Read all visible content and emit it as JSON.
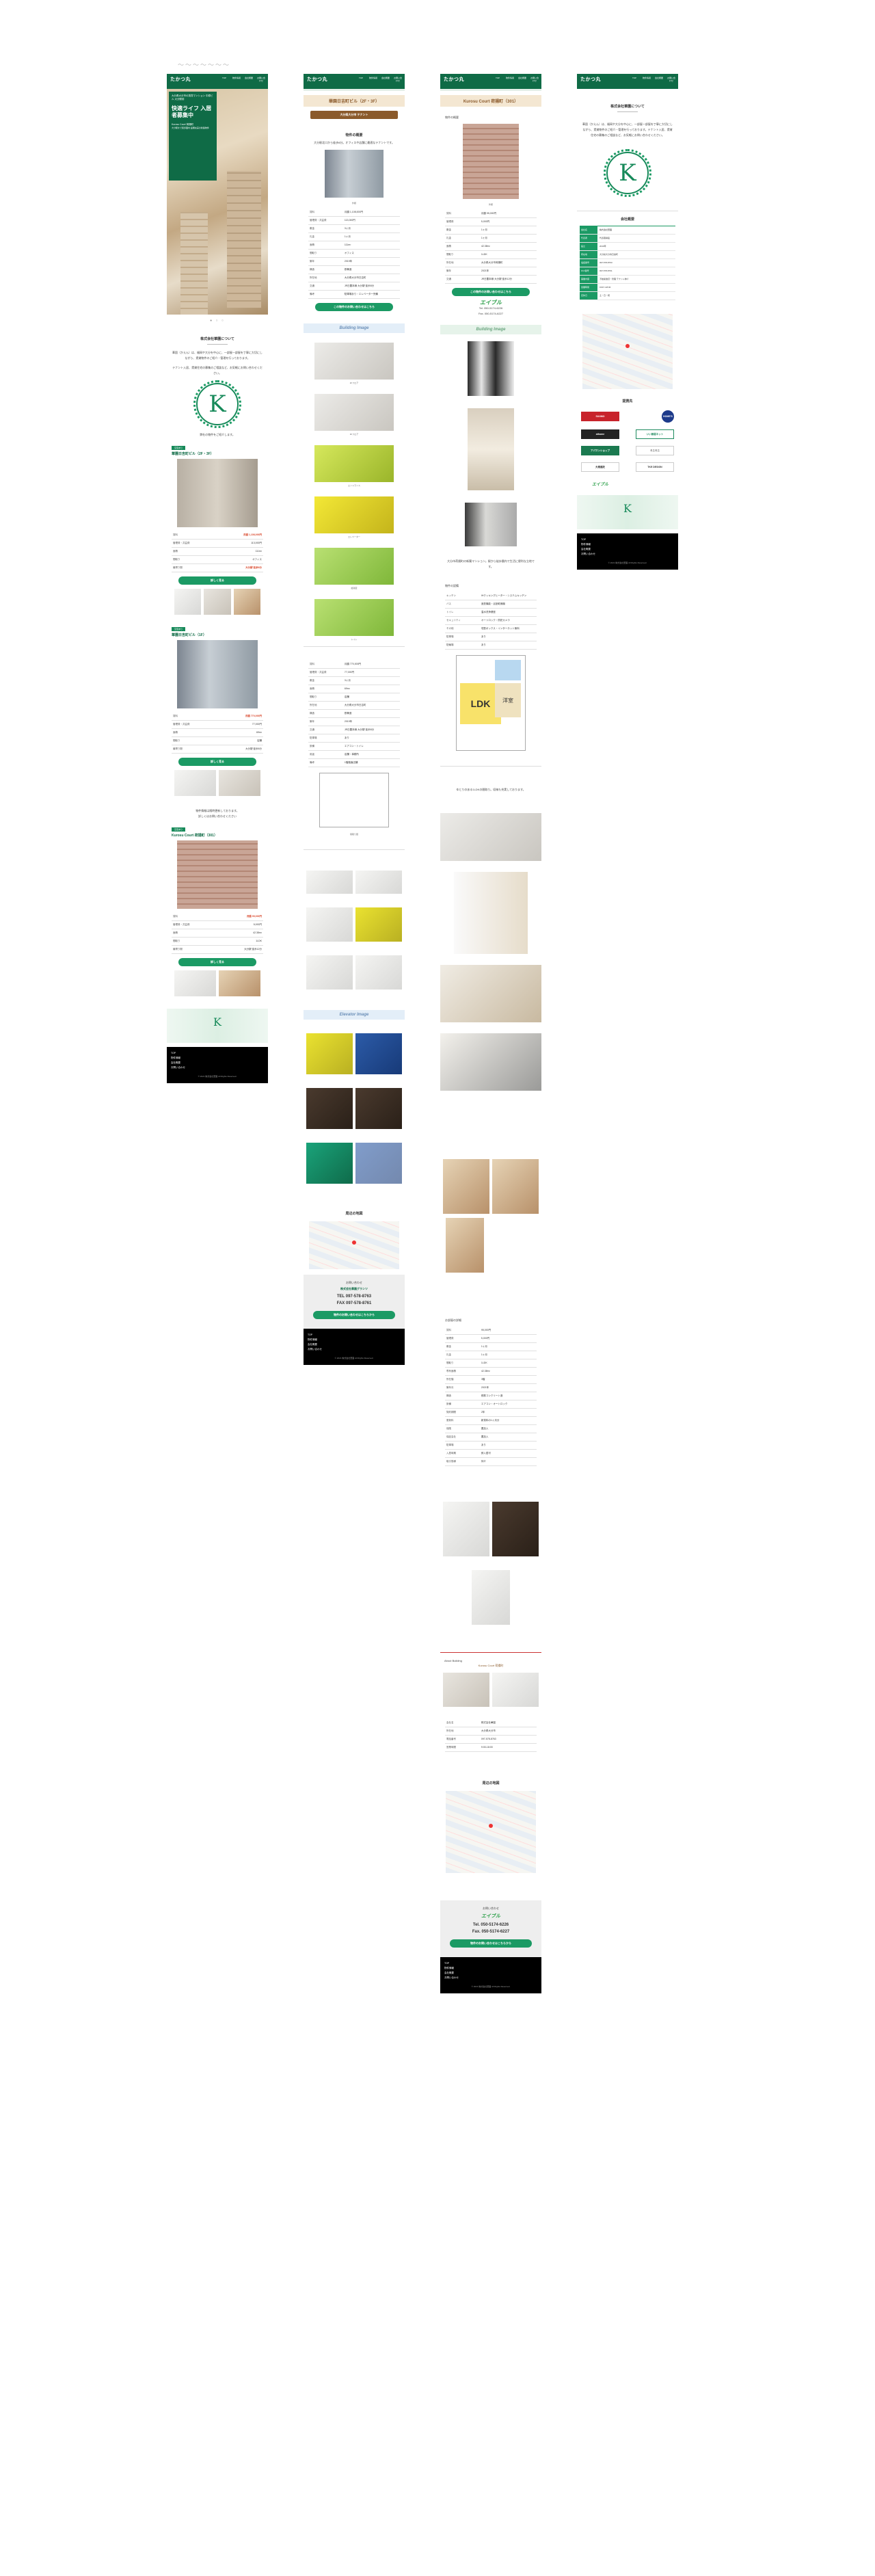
{
  "header": {
    "logo": "たかつ丸",
    "nav": [
      "TOP",
      "物件情報",
      "会社概要",
      "お問い合わせ"
    ]
  },
  "col1": {
    "hero_panel": {
      "line1": "大分県大分市の賃貸マンション 中原ビル 大分駅前",
      "headline": "快適ライフ 入居者募集中",
      "sub": "Kurosu Court 荷揚町",
      "note": "大分駅まで徒歩圏内 設備充実の新築物件"
    },
    "company_title": "株式会社華園について",
    "company_text": "華園（かえん）は、福岡や大分を中心に、一部屋一部屋を丁寧に大切にしながら、賃貸物件のご紹介・管理を行っております。",
    "company_text2": "テナント入居、賃貸住宅の募集のご相談など、お気軽にお問い合わせください。",
    "emblem_letter": "K",
    "emblem_caption": "弊社の物件をご紹介します。",
    "listing1": {
      "badge": "空室あり",
      "name": "華園日吉町ビル（2F・3F）",
      "labels": [
        "賃料",
        "管理費・共益費",
        "面積",
        "間取り",
        "最寄り駅"
      ],
      "values": [
        "月額 1,108,000円",
        "113,000円",
        "111m²",
        "オフィス",
        "大分駅 徒歩8分"
      ],
      "button": "詳しく見る"
    },
    "listing2": {
      "badge": "空室あり",
      "name": "華園日吉町ビル（1F）",
      "labels": [
        "賃料",
        "管理費・共益費",
        "面積",
        "間取り",
        "最寄り駅"
      ],
      "values": [
        "月額 770,000円",
        "77,000円",
        "69m²",
        "店舗",
        "大分駅 徒歩8分"
      ],
      "button": "詳しく見る"
    },
    "notice": "物件情報は随時更新しております。",
    "notice_sub": "詳しくはお問い合わせください",
    "listing3": {
      "badge": "空室あり",
      "name": "Kurosu Court 荷揚町（301）",
      "labels": [
        "賃料",
        "管理費・共益費",
        "面積",
        "間取り",
        "最寄り駅"
      ],
      "values": [
        "月額 95,000円",
        "5,000円",
        "42.38m²",
        "1LDK",
        "大分駅 徒歩12分"
      ],
      "button": "詳しく見る"
    },
    "footer": [
      "TOP",
      "物件情報",
      "会社概要",
      "お問い合わせ"
    ],
    "copyright": "© 2021 株式会社華園 All Rights Reserved."
  },
  "col2": {
    "page_title": "華園日吉町ビル（2F・3F）",
    "tag_button": "大分県大分市 テナント",
    "intro_title": "物件の概要",
    "intro_text": "大分駅北口から徒歩8分。オフィスや店舗に最適なテナントです。",
    "facade_caption": "外観",
    "table": [
      [
        "賃料",
        "月額 1,108,000円"
      ],
      [
        "管理費・共益費",
        "113,000円"
      ],
      [
        "敷金",
        "3ヶ月"
      ],
      [
        "礼金",
        "1ヶ月"
      ],
      [
        "面積",
        "111m²"
      ],
      [
        "間取り",
        "オフィス"
      ],
      [
        "築年",
        "2019年"
      ],
      [
        "構造",
        "鉄骨造"
      ],
      [
        "所在地",
        "大分県大分市日吉町"
      ],
      [
        "交通",
        "JR日豊本線 大分駅 徒歩8分"
      ],
      [
        "備考",
        "駐車場あり・エレベーター完備"
      ]
    ],
    "contact_btn": "この物件のお問い合わせはこちら",
    "building_title": "Building Image",
    "photo_captions": [
      "2Fフロア",
      "3Fフロア",
      "エントランス",
      "エレベーター",
      "給湯室",
      "トイレ"
    ],
    "table2": [
      [
        "賃料",
        "月額 770,000円"
      ],
      [
        "管理費・共益費",
        "77,000円"
      ],
      [
        "敷金",
        "3ヶ月"
      ],
      [
        "面積",
        "69m²"
      ],
      [
        "間取り",
        "店舗"
      ],
      [
        "所在地",
        "大分県大分市日吉町"
      ],
      [
        "構造",
        "鉄骨造"
      ],
      [
        "築年",
        "2019年"
      ],
      [
        "交通",
        "JR日豊本線 大分駅 徒歩8分"
      ],
      [
        "駐車場",
        "あり"
      ],
      [
        "設備",
        "エアコン・トイレ"
      ],
      [
        "用途",
        "店舗・事務所"
      ],
      [
        "備考",
        "1階路面店舗"
      ]
    ],
    "plan_caption": "間取り図",
    "grid_captions": [
      "キッチン",
      "洗面台",
      "洗面所",
      "トイレ",
      "廊下",
      "玄関"
    ],
    "elevator_title": "Elevator Image",
    "map_title": "周辺の地図",
    "contact_box": {
      "title": "お問い合わせ",
      "name": "株式会社華園グランツ",
      "tel1": "TEL 097-578-8763",
      "tel2": "FAX 097-578-8761",
      "btn": "物件のお問い合わせはこちらから"
    },
    "footer": [
      "TOP",
      "物件情報",
      "会社概要",
      "お問い合わせ"
    ],
    "copyright": "© 2021 株式会社華園 All Rights Reserved."
  },
  "col3": {
    "page_title": "Kurosu Court 荷揚町（301）",
    "intro_title": "物件の概要",
    "facade_caption": "外観",
    "table": [
      [
        "賃料",
        "月額 95,000円"
      ],
      [
        "管理費",
        "5,000円"
      ],
      [
        "敷金",
        "1ヶ月"
      ],
      [
        "礼金",
        "1ヶ月"
      ],
      [
        "面積",
        "42.38m²"
      ],
      [
        "間取り",
        "1LDK"
      ],
      [
        "所在地",
        "大分県大分市荷揚町"
      ],
      [
        "築年",
        "2021年"
      ],
      [
        "交通",
        "JR日豊本線 大分駅 徒歩12分"
      ]
    ],
    "contact_btn": "この物件のお問い合わせはこちら",
    "company_logo": "エイブル",
    "tel1": "Tel. 050-5174-6226",
    "tel2": "Fax. 050-5174-6227",
    "building_title": "Building Image",
    "desc": "大分市荷揚町の新築マンション。駅から徒歩圏内で生活に便利な立地です。",
    "spec_title": "物件の設備",
    "spec": [
      [
        "キッチン",
        "IHクッキングヒーター・システムキッチン"
      ],
      [
        "バス",
        "追焚機能・浴室乾燥機"
      ],
      [
        "トイレ",
        "温水洗浄便座"
      ],
      [
        "セキュリティ",
        "オートロック・防犯カメラ"
      ],
      [
        "その他",
        "宅配ボックス・インターネット無料"
      ],
      [
        "駐車場",
        "あり"
      ],
      [
        "駐輪場",
        "あり"
      ]
    ],
    "floor_ldk": "LDK",
    "floor_room": "洋室",
    "spec_text": "ゆとりのある1LDKの間取り。収納も充実しております。",
    "room_table_title": "お部屋の詳細",
    "room_table": [
      [
        "賃料",
        "95,000円"
      ],
      [
        "管理費",
        "5,000円"
      ],
      [
        "敷金",
        "1ヶ月"
      ],
      [
        "礼金",
        "1ヶ月"
      ],
      [
        "間取り",
        "1LDK"
      ],
      [
        "専有面積",
        "42.38m²"
      ],
      [
        "所在階",
        "3階"
      ],
      [
        "築年月",
        "2021年"
      ],
      [
        "構造",
        "鉄筋コンクリート造"
      ],
      [
        "設備",
        "エアコン・オートロック"
      ],
      [
        "契約期間",
        "2年"
      ],
      [
        "更新料",
        "新賃料の1ヶ月分"
      ],
      [
        "保険",
        "要加入"
      ],
      [
        "保証会社",
        "要加入"
      ],
      [
        "駐車場",
        "あり"
      ],
      [
        "入居時期",
        "即入居可"
      ],
      [
        "取引態様",
        "仲介"
      ]
    ],
    "about_title": "About Building",
    "about_sub": "Kurosu Court 荷揚町",
    "company_table": [
      [
        "会社名",
        "株式会社華園"
      ],
      [
        "所在地",
        "大分県大分市"
      ],
      [
        "電話番号",
        "097-578-8763"
      ],
      [
        "営業時間",
        "9:00-18:00"
      ]
    ],
    "map_title": "周辺の地図",
    "contact_box": {
      "title": "お問い合わせ",
      "logo": "エイブル",
      "tel1": "Tel. 050-5174-6226",
      "tel2": "Fax. 050-5174-6227",
      "btn": "物件のお問い合わせはこちらから"
    },
    "footer": [
      "TOP",
      "物件情報",
      "会社概要",
      "お問い合わせ"
    ],
    "copyright": "© 2021 株式会社華園 All Rights Reserved."
  },
  "col4": {
    "title": "株式会社華園について",
    "text": "華園（かえん）は、福岡や大分を中心に、一部屋一部屋を丁寧に大切にしながら、賃貸物件のご紹介・管理を行っております。テナント入居、賃貸住宅の募集のご相談など、お気軽にお問い合わせください。",
    "emblem_letter": "K",
    "company_title": "会社概要",
    "company": [
      [
        "会社名",
        "株式会社華園"
      ],
      [
        "代表者",
        "代表取締役"
      ],
      [
        "設立",
        "2019年"
      ],
      [
        "所在地",
        "大分県大分市日吉町"
      ],
      [
        "電話番号",
        "097-578-8763"
      ],
      [
        "FAX番号",
        "097-578-8761"
      ],
      [
        "事業内容",
        "不動産賃貸・管理 テナント仲介"
      ],
      [
        "営業時間",
        "9:00〜18:00"
      ],
      [
        "定休日",
        "土・日・祝"
      ]
    ],
    "partners_title": "提携先",
    "partners": [
      "SUUMO",
      "HOME'S",
      "athome",
      "いい部屋ネット",
      "アパマンショップ",
      "ミニミニ",
      "大東建託",
      "エイブル",
      "TKE DESIGN"
    ],
    "footer": [
      "TOP",
      "物件情報",
      "会社概要",
      "お問い合わせ"
    ],
    "copyright": "© 2021 株式会社華園 All Rights Reserved."
  }
}
